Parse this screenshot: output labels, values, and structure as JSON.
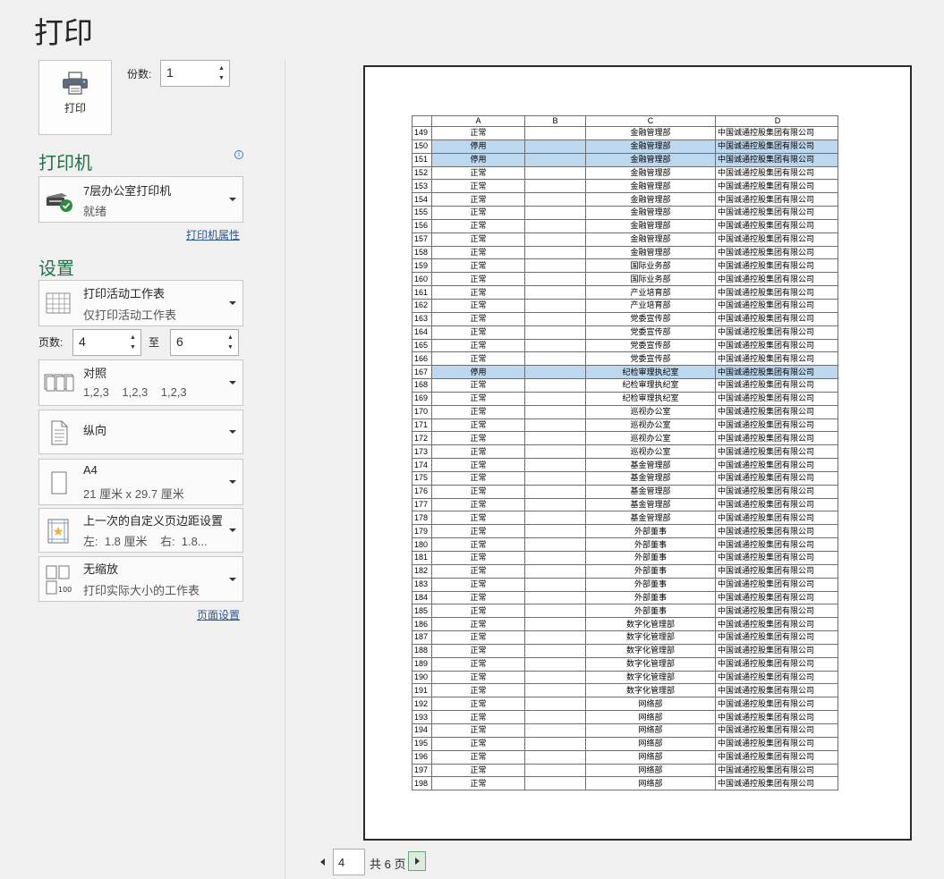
{
  "title": "打印",
  "print_button": {
    "label": "打印"
  },
  "copies": {
    "label": "份数:",
    "value": "1"
  },
  "printer": {
    "section_title": "打印机",
    "name": "7层办公室打印机",
    "status": "就绪",
    "properties_link": "打印机属性"
  },
  "settings": {
    "section_title": "设置",
    "scope": {
      "title": "打印活动工作表",
      "subtitle": "仅打印活动工作表"
    },
    "pages_label": "页数:",
    "pages_from": "4",
    "to_label": "至",
    "pages_to": "6",
    "collate": {
      "title": "对照",
      "subtitle": "1,2,3    1,2,3    1,2,3"
    },
    "orientation": {
      "title": "纵向"
    },
    "paper": {
      "title": "A4",
      "subtitle": "21 厘米 x 29.7 厘米"
    },
    "margins": {
      "title": "上一次的自定义页边距设置",
      "subtitle": "左:  1.8 厘米    右:  1.8..."
    },
    "scaling": {
      "title": "无缩放",
      "subtitle": "打印实际大小的工作表",
      "icon_text": "100"
    },
    "page_setup_link": "页面设置"
  },
  "preview": {
    "columns": [
      "A",
      "B",
      "C",
      "D"
    ],
    "rows": [
      [
        "149",
        "正常",
        "",
        "金融管理部",
        "中国诚通控股集团有限公司"
      ],
      [
        "150",
        "停用",
        "",
        "金融管理部",
        "中国诚通控股集团有限公司"
      ],
      [
        "151",
        "停用",
        "",
        "金融管理部",
        "中国诚通控股集团有限公司"
      ],
      [
        "152",
        "正常",
        "",
        "金融管理部",
        "中国诚通控股集团有限公司"
      ],
      [
        "153",
        "正常",
        "",
        "金融管理部",
        "中国诚通控股集团有限公司"
      ],
      [
        "154",
        "正常",
        "",
        "金融管理部",
        "中国诚通控股集团有限公司"
      ],
      [
        "155",
        "正常",
        "",
        "金融管理部",
        "中国诚通控股集团有限公司"
      ],
      [
        "156",
        "正常",
        "",
        "金融管理部",
        "中国诚通控股集团有限公司"
      ],
      [
        "157",
        "正常",
        "",
        "金融管理部",
        "中国诚通控股集团有限公司"
      ],
      [
        "158",
        "正常",
        "",
        "金融管理部",
        "中国诚通控股集团有限公司"
      ],
      [
        "159",
        "正常",
        "",
        "国际业务部",
        "中国诚通控股集团有限公司"
      ],
      [
        "160",
        "正常",
        "",
        "国际业务部",
        "中国诚通控股集团有限公司"
      ],
      [
        "161",
        "正常",
        "",
        "产业培育部",
        "中国诚通控股集团有限公司"
      ],
      [
        "162",
        "正常",
        "",
        "产业培育部",
        "中国诚通控股集团有限公司"
      ],
      [
        "163",
        "正常",
        "",
        "党委宣传部",
        "中国诚通控股集团有限公司"
      ],
      [
        "164",
        "正常",
        "",
        "党委宣传部",
        "中国诚通控股集团有限公司"
      ],
      [
        "165",
        "正常",
        "",
        "党委宣传部",
        "中国诚通控股集团有限公司"
      ],
      [
        "166",
        "正常",
        "",
        "党委宣传部",
        "中国诚通控股集团有限公司"
      ],
      [
        "167",
        "停用",
        "",
        "纪检审理执纪室",
        "中国诚通控股集团有限公司"
      ],
      [
        "168",
        "正常",
        "",
        "纪检审理执纪室",
        "中国诚通控股集团有限公司"
      ],
      [
        "169",
        "正常",
        "",
        "纪检审理执纪室",
        "中国诚通控股集团有限公司"
      ],
      [
        "170",
        "正常",
        "",
        "巡视办公室",
        "中国诚通控股集团有限公司"
      ],
      [
        "171",
        "正常",
        "",
        "巡视办公室",
        "中国诚通控股集团有限公司"
      ],
      [
        "172",
        "正常",
        "",
        "巡视办公室",
        "中国诚通控股集团有限公司"
      ],
      [
        "173",
        "正常",
        "",
        "巡视办公室",
        "中国诚通控股集团有限公司"
      ],
      [
        "174",
        "正常",
        "",
        "基金管理部",
        "中国诚通控股集团有限公司"
      ],
      [
        "175",
        "正常",
        "",
        "基金管理部",
        "中国诚通控股集团有限公司"
      ],
      [
        "176",
        "正常",
        "",
        "基金管理部",
        "中国诚通控股集团有限公司"
      ],
      [
        "177",
        "正常",
        "",
        "基金管理部",
        "中国诚通控股集团有限公司"
      ],
      [
        "178",
        "正常",
        "",
        "基金管理部",
        "中国诚通控股集团有限公司"
      ],
      [
        "179",
        "正常",
        "",
        "外部董事",
        "中国诚通控股集团有限公司"
      ],
      [
        "180",
        "正常",
        "",
        "外部董事",
        "中国诚通控股集团有限公司"
      ],
      [
        "181",
        "正常",
        "",
        "外部董事",
        "中国诚通控股集团有限公司"
      ],
      [
        "182",
        "正常",
        "",
        "外部董事",
        "中国诚通控股集团有限公司"
      ],
      [
        "183",
        "正常",
        "",
        "外部董事",
        "中国诚通控股集团有限公司"
      ],
      [
        "184",
        "正常",
        "",
        "外部董事",
        "中国诚通控股集团有限公司"
      ],
      [
        "185",
        "正常",
        "",
        "外部董事",
        "中国诚通控股集团有限公司"
      ],
      [
        "186",
        "正常",
        "",
        "数字化管理部",
        "中国诚通控股集团有限公司"
      ],
      [
        "187",
        "正常",
        "",
        "数字化管理部",
        "中国诚通控股集团有限公司"
      ],
      [
        "188",
        "正常",
        "",
        "数字化管理部",
        "中国诚通控股集团有限公司"
      ],
      [
        "189",
        "正常",
        "",
        "数字化管理部",
        "中国诚通控股集团有限公司"
      ],
      [
        "190",
        "正常",
        "",
        "数字化管理部",
        "中国诚通控股集团有限公司"
      ],
      [
        "191",
        "正常",
        "",
        "数字化管理部",
        "中国诚通控股集团有限公司"
      ],
      [
        "192",
        "正常",
        "",
        "网络部",
        "中国诚通控股集团有限公司"
      ],
      [
        "193",
        "正常",
        "",
        "网络部",
        "中国诚通控股集团有限公司"
      ],
      [
        "194",
        "正常",
        "",
        "网络部",
        "中国诚通控股集团有限公司"
      ],
      [
        "195",
        "正常",
        "",
        "网络部",
        "中国诚通控股集团有限公司"
      ],
      [
        "196",
        "正常",
        "",
        "网络部",
        "中国诚通控股集团有限公司"
      ],
      [
        "197",
        "正常",
        "",
        "网络部",
        "中国诚通控股集团有限公司"
      ],
      [
        "198",
        "正常",
        "",
        "网络部",
        "中国诚通控股集团有限公司"
      ]
    ],
    "highlighted_rows": [
      "150",
      "151",
      "167"
    ],
    "highlight_color": "#bdd7ee"
  },
  "pager": {
    "current": "4",
    "total_text": "共 6 页"
  },
  "colors": {
    "accent": "#217346",
    "link": "#2b579a"
  }
}
